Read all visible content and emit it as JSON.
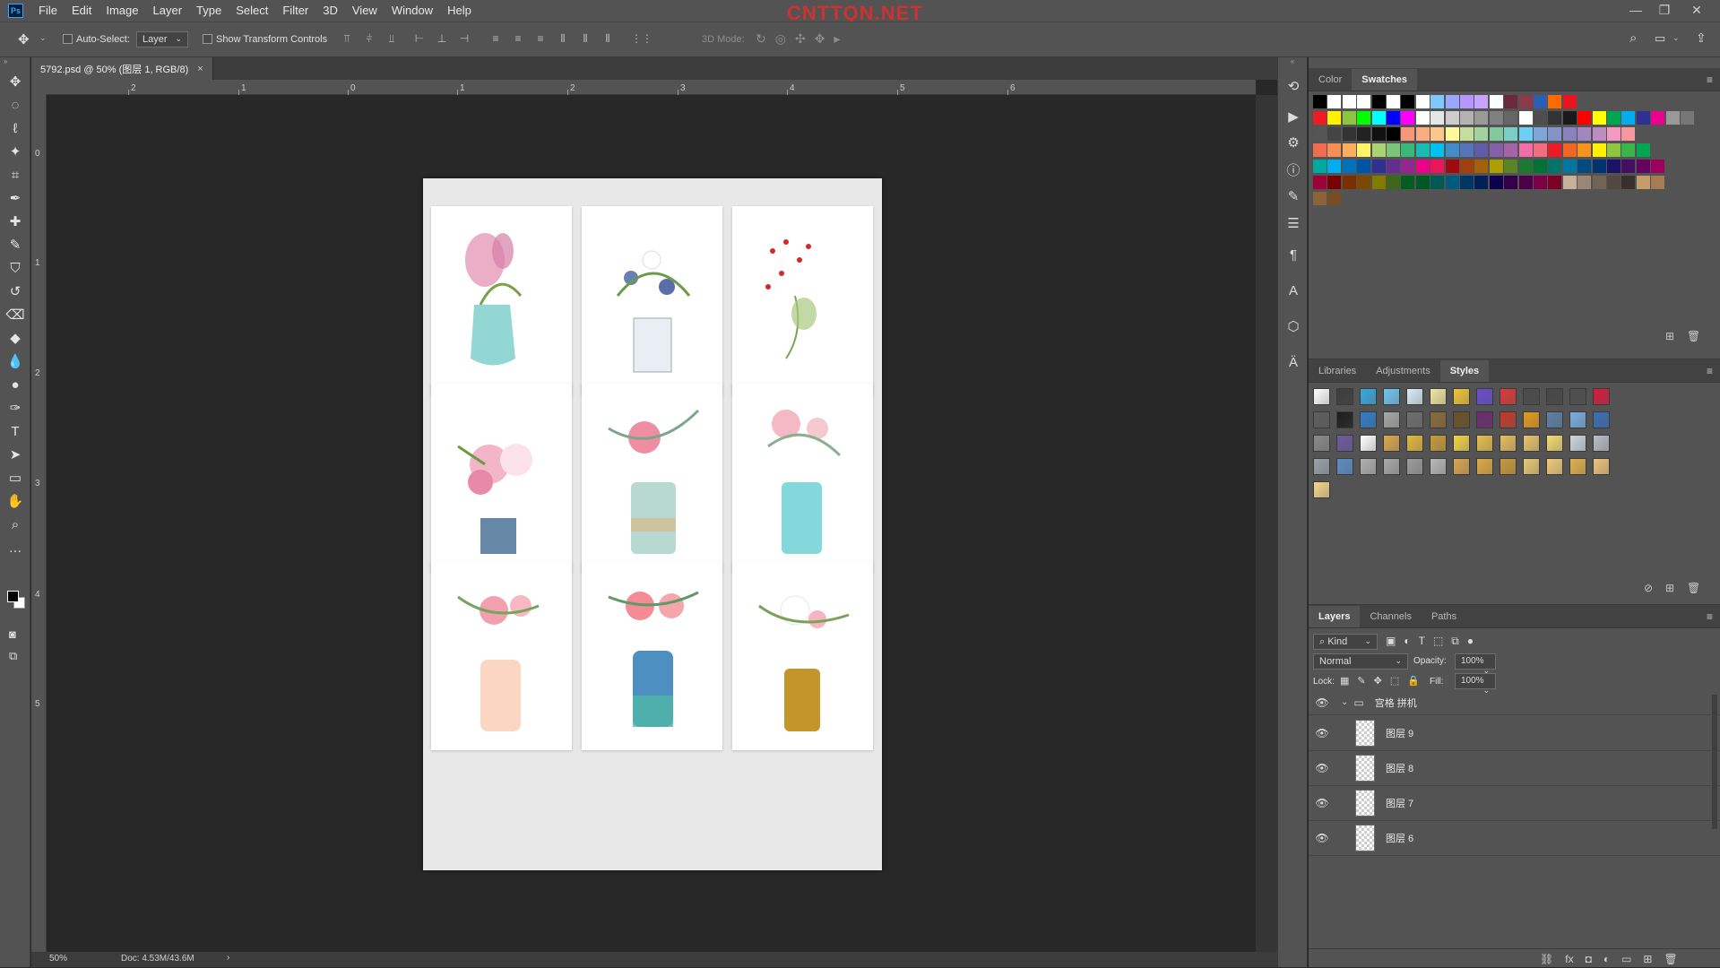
{
  "app": {
    "logo": "Ps",
    "watermark": "CNTTQN.NET"
  },
  "menu": [
    "File",
    "Edit",
    "Image",
    "Layer",
    "Type",
    "Select",
    "Filter",
    "3D",
    "View",
    "Window",
    "Help"
  ],
  "window_controls": {
    "minimize": "—",
    "restore": "❐",
    "close": "✕"
  },
  "options": {
    "auto_select_label": "Auto-Select:",
    "auto_select_value": "Layer",
    "show_transform_label": "Show Transform Controls",
    "mode_3d_label": "3D Mode:"
  },
  "document_tab": {
    "title": "5792.psd @ 50% (图层 1, RGB/8)",
    "close": "×"
  },
  "ruler_h": [
    "2",
    "1",
    "0",
    "1",
    "2",
    "3",
    "4",
    "5",
    "6"
  ],
  "ruler_v": [
    "0",
    "1",
    "2",
    "3",
    "4",
    "5"
  ],
  "status": {
    "zoom": "50%",
    "doc": "Doc: 4.53M/43.6M",
    "arrow": "›"
  },
  "tools": [
    "move-tool",
    "marquee-tool",
    "lasso-tool",
    "magic-wand-tool",
    "crop-tool",
    "eyedropper-tool",
    "healing-tool",
    "brush-tool",
    "stamp-tool",
    "history-brush-tool",
    "eraser-tool",
    "paint-bucket-tool",
    "blur-tool",
    "dodge-tool",
    "pen-tool",
    "type-tool",
    "path-select-tool",
    "rectangle-tool",
    "hand-tool",
    "zoom-tool",
    "more-tools"
  ],
  "color_panel": {
    "tabs": [
      "Color",
      "Swatches"
    ],
    "active": "Swatches"
  },
  "styles_panel": {
    "tabs": [
      "Libraries",
      "Adjustments",
      "Styles"
    ],
    "active": "Styles"
  },
  "layers_panel": {
    "tabs": [
      "Layers",
      "Channels",
      "Paths"
    ],
    "active": "Layers",
    "filter_kind": "Kind",
    "blend_mode": "Normal",
    "opacity_label": "Opacity:",
    "opacity_value": "100%",
    "lock_label": "Lock:",
    "fill_label": "Fill:",
    "fill_value": "100%",
    "group_name": "宫格 拼机",
    "layers": [
      "图层 9",
      "图层 8",
      "图层 7",
      "图层 6"
    ]
  },
  "swatch_rows": [
    [
      "#000000",
      "#ffffff",
      "#ffffff",
      "#ffffff",
      "#000000",
      "#ffffff",
      "#000000",
      "#ffffff",
      "#7dc8ff",
      "#9aa6ff",
      "#b497ff",
      "#c7a2ff",
      "#ffffff",
      "#6a2a3a",
      "#8a3a4a",
      "#2b5fb3",
      "#ff6a00",
      "#e8131e"
    ],
    [
      "#ed1c24",
      "#fff200",
      "#8cc63f",
      "#00ff00",
      "#00ffff",
      "#0000ff",
      "#ff00ff",
      "#ffffff",
      "#e6e6e6",
      "#cccccc",
      "#b3b3b3",
      "#999999",
      "#808080",
      "#666666",
      "#ffffff",
      "#4d4d4d",
      "#333333",
      "#1a1a1a",
      "#ff0000",
      "#ffff00",
      "#00a651",
      "#00aeef",
      "#2e3192",
      "#ec008c",
      "#999999",
      "#777777"
    ],
    [
      "#555555",
      "#444444",
      "#333333",
      "#222222",
      "#111111",
      "#000000",
      "#f7977a",
      "#f9ad81",
      "#fdc68a",
      "#fff79a",
      "#c4df9b",
      "#a3d39c",
      "#82ca9d",
      "#7bcdc8",
      "#6ecff6",
      "#7ea7d8",
      "#8493ca",
      "#8882be",
      "#a187be",
      "#bc8dbf",
      "#f49ac2",
      "#f6989d"
    ],
    [
      "#f26c4f",
      "#f68e55",
      "#fbaf5c",
      "#fff467",
      "#acd372",
      "#7cc576",
      "#3bb878",
      "#1abbb4",
      "#00bff3",
      "#438cca",
      "#5574b9",
      "#605ca8",
      "#855fa8",
      "#a763a8",
      "#f06ea9",
      "#f26d7d",
      "#ed1c24",
      "#f26522",
      "#f7941d",
      "#fff200",
      "#8dc73f",
      "#39b54a",
      "#00a651"
    ],
    [
      "#00a99d",
      "#00aeef",
      "#0072bc",
      "#0054a6",
      "#2e3192",
      "#662d91",
      "#92278f",
      "#ec008c",
      "#ed145b",
      "#9e0b0f",
      "#a0410d",
      "#a36209",
      "#aba000",
      "#598527",
      "#1a7b30",
      "#007236",
      "#00746b",
      "#0076a3",
      "#004b80",
      "#003471",
      "#1b1464",
      "#440e62",
      "#630460",
      "#9e005d"
    ],
    [
      "#9e0039",
      "#790000",
      "#7b2e00",
      "#7d4900",
      "#827b00",
      "#406618",
      "#005e20",
      "#005826",
      "#005952",
      "#005b7f",
      "#003663",
      "#002157",
      "#0d004c",
      "#32004b",
      "#4b0049",
      "#7b0046",
      "#7a0026",
      "#c7b299",
      "#998675",
      "#736357",
      "#534741",
      "#37302d",
      "#c69c6d",
      "#a67c52"
    ],
    [
      "#8c6239",
      "#754c24"
    ]
  ]
}
